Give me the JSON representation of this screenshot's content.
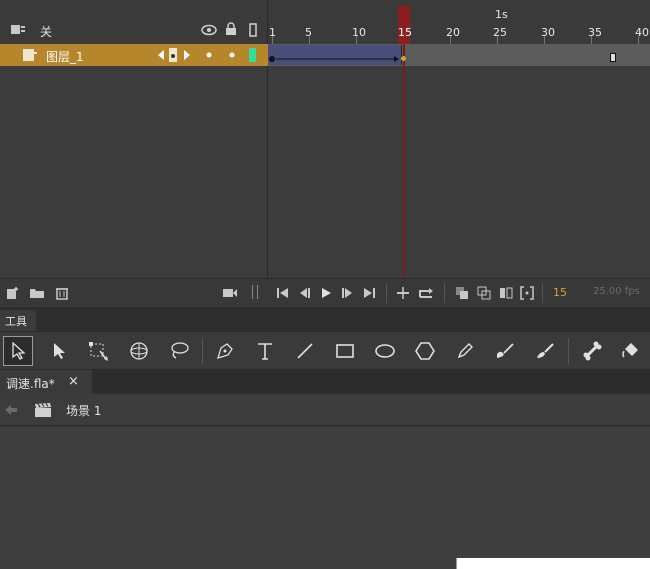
{
  "timeline": {
    "header": {
      "layer_col_title": "关",
      "time_marker": "1s"
    },
    "ruler_labels": [
      "1",
      "5",
      "10",
      "15",
      "20",
      "25",
      "30",
      "35",
      "40"
    ],
    "playhead_frame": "15",
    "layer": {
      "name": "图层_1"
    },
    "footer": {
      "current_frame": "15",
      "fps": "25.00 fps"
    }
  },
  "tools_panel": {
    "tab_label": "工具"
  },
  "document": {
    "tab_label": "调速.fla*",
    "close": "×"
  },
  "scene": {
    "label": "场景 1"
  },
  "colors": {
    "layer_highlight": "#b5862c",
    "playhead": "#8c1e1e",
    "frame_indicator": "#e0a030",
    "tween": "#4a4e7a",
    "layer_color_box": "#2fe0a0"
  }
}
